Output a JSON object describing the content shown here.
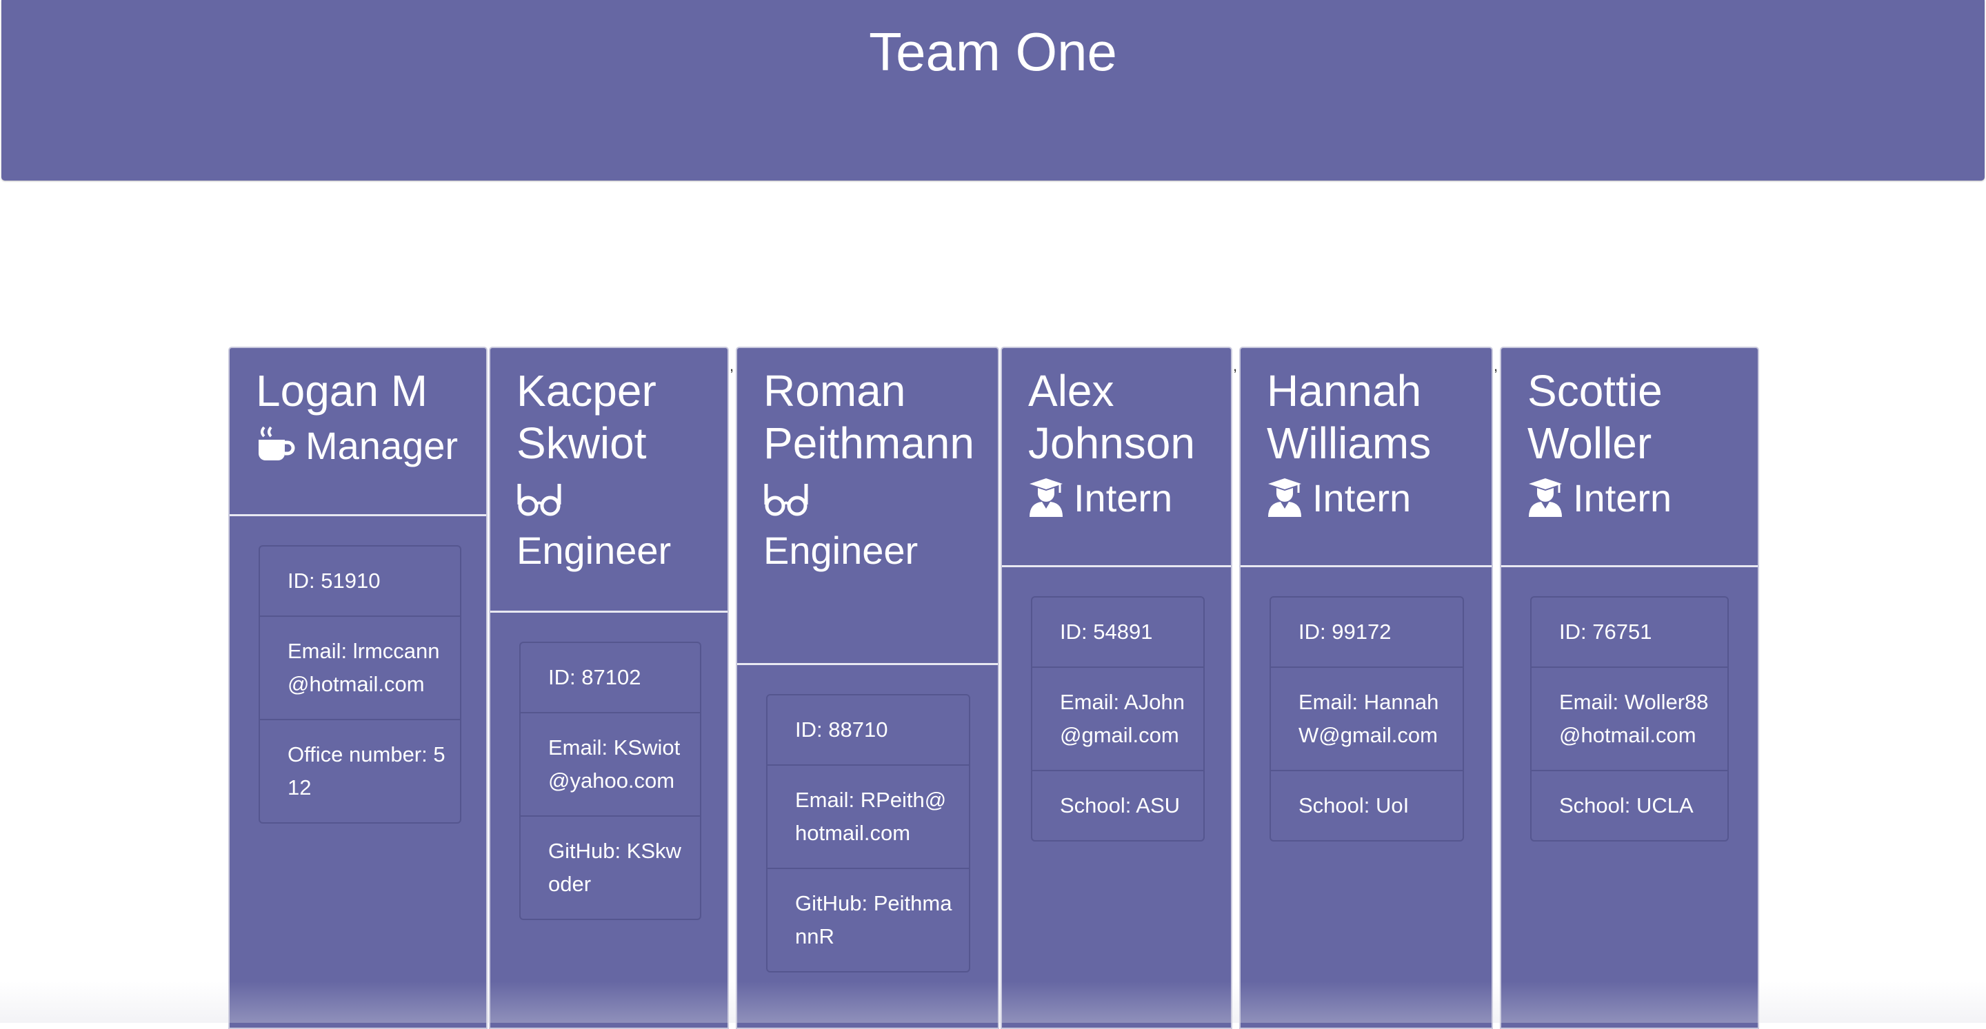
{
  "header": {
    "title": "Team One"
  },
  "separators": [
    ",",
    ",",
    ","
  ],
  "cards": [
    {
      "name": "Logan M",
      "icon": "coffee-mug-icon",
      "role": "Manager",
      "id": "ID: 51910",
      "email": "Email: lrmccann@hotmail.com",
      "extra": "Office number: 512"
    },
    {
      "name": "Kacper Skwiot",
      "icon": "glasses-icon",
      "role": "Engineer",
      "id": "ID: 87102",
      "email": "Email: KSwiot@yahoo.com",
      "extra": "GitHub: KSkwoder"
    },
    {
      "name": "Roman Peithmann",
      "icon": "glasses-icon",
      "role": "Engineer",
      "id": "ID: 88710",
      "email": "Email: RPeith@hotmail.com",
      "extra": "GitHub: PeithmannR"
    },
    {
      "name": "Alex Johnson",
      "icon": "graduate-icon",
      "role": "Intern",
      "id": "ID: 54891",
      "email": "Email: AJohn@gmail.com",
      "extra": "School: ASU"
    },
    {
      "name": "Hannah Williams",
      "icon": "graduate-icon",
      "role": "Intern",
      "id": "ID: 99172",
      "email": "Email: HannahW@gmail.com",
      "extra": "School: UoI"
    },
    {
      "name": "Scottie Woller",
      "icon": "graduate-icon",
      "role": "Intern",
      "id": "ID: 76751",
      "email": "Email: Woller88@hotmail.com",
      "extra": "School: UCLA"
    }
  ],
  "colors": {
    "card_bg": "#6667a3",
    "text": "#ffffff"
  }
}
